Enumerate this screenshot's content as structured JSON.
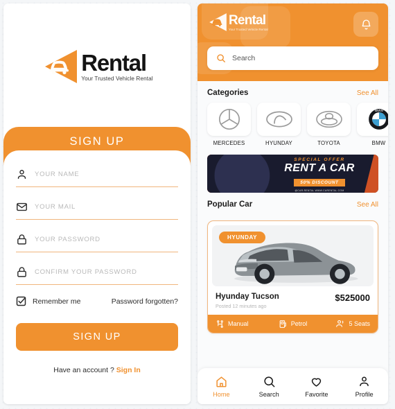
{
  "brand": {
    "name": "Rental",
    "tagline": "Your Trusted Vehicle Rental",
    "accent": "#f0912f",
    "dark": "#141414"
  },
  "signup": {
    "band_title": "SIGN UP",
    "fields": [
      {
        "icon": "user-icon",
        "placeholder": "YOUR NAME",
        "value": ""
      },
      {
        "icon": "mail-icon",
        "placeholder": "YOUR MAIL",
        "value": ""
      },
      {
        "icon": "lock-icon",
        "placeholder": "YOUR PASSWORD",
        "value": ""
      },
      {
        "icon": "lock-icon",
        "placeholder": "CONFIRM YOUR PASSWORD",
        "value": ""
      }
    ],
    "remember_label": "Remember me",
    "remember_checked": true,
    "forgot_label": "Password forgotten?",
    "submit_label": "SIGN UP",
    "have_account_text": "Have an account ?",
    "sign_in_label": "Sign In"
  },
  "home": {
    "notification_icon": "bell-icon",
    "search": {
      "placeholder": "Search",
      "value": "",
      "icon": "search-icon"
    },
    "categories": {
      "title": "Categories",
      "see_all": "See All",
      "items": [
        {
          "name": "MERCEDES",
          "logo": "mercedes-logo"
        },
        {
          "name": "HYUNDAY",
          "logo": "hyundai-logo"
        },
        {
          "name": "TOYOTA",
          "logo": "toyota-logo"
        },
        {
          "name": "BMW",
          "logo": "bmw-logo"
        }
      ]
    },
    "banner": {
      "offer": "SPECIAL OFFER",
      "headline": "RENT A CAR",
      "discount": "50% DISCOUNT",
      "contact": "@CAR.RENTAL          WWW.CARENTAL.COM"
    },
    "popular": {
      "title": "Popular Car",
      "see_all": "See All",
      "card": {
        "badge": "HYUNDAY",
        "name": "Hyunday Tucson",
        "posted": "Posted 12 minutes ago",
        "price": "$525000",
        "specs": [
          {
            "icon": "gearshift-icon",
            "label": "Manual"
          },
          {
            "icon": "fuel-icon",
            "label": "Petrol"
          },
          {
            "icon": "seats-icon",
            "label": "5 Seats"
          }
        ]
      }
    },
    "tabs": [
      {
        "label": "Home",
        "icon": "home-icon",
        "active": true
      },
      {
        "label": "Search",
        "icon": "search-icon",
        "active": false
      },
      {
        "label": "Favorite",
        "icon": "heart-icon",
        "active": false
      },
      {
        "label": "Profile",
        "icon": "person-icon",
        "active": false
      }
    ]
  }
}
